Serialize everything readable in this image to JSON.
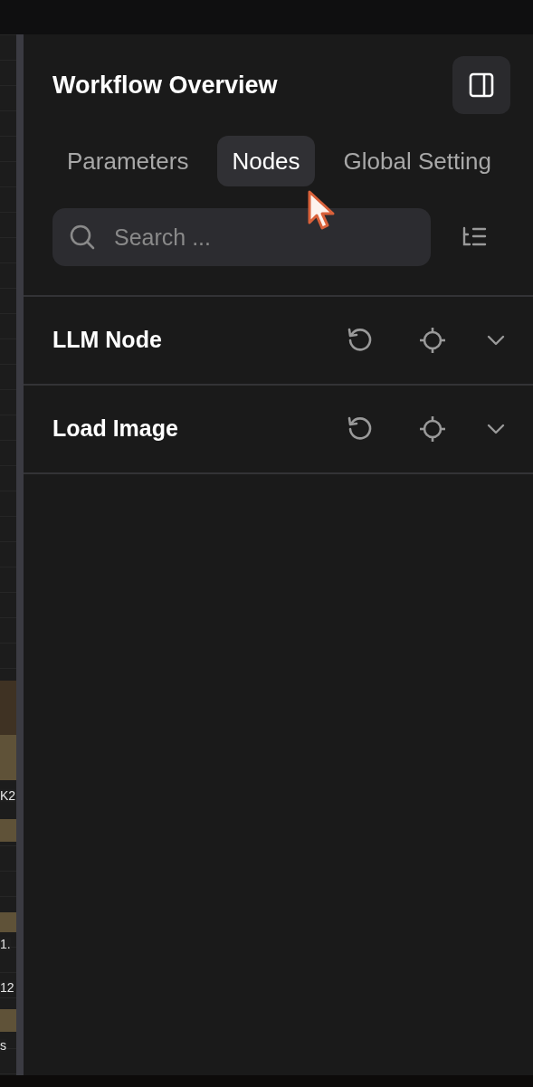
{
  "sidebar": {
    "title": "Workflow Overview"
  },
  "tabs": [
    {
      "label": "Parameters",
      "selected": false
    },
    {
      "label": "Nodes",
      "selected": true
    },
    {
      "label": "Global Setting",
      "selected": false
    }
  ],
  "search": {
    "placeholder": "Search ..."
  },
  "nodes": [
    {
      "name": "LLM Node",
      "expanded": false
    },
    {
      "name": "Load Image",
      "expanded": false
    }
  ],
  "canvas_fragments": [
    {
      "text": "K2"
    },
    {
      "text": "1."
    },
    {
      "text": "12"
    },
    {
      "text": "s"
    }
  ]
}
